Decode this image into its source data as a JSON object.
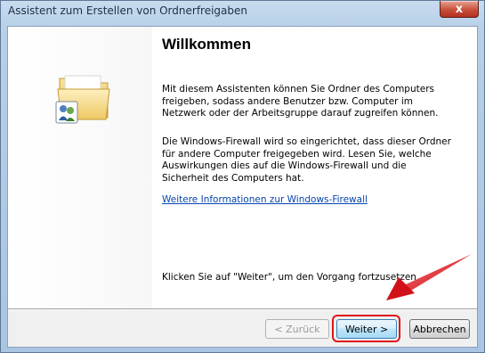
{
  "window": {
    "title": "Assistent zum Erstellen von Ordnerfreigaben",
    "close_label": "x"
  },
  "content": {
    "heading": "Willkommen",
    "paragraph1": "Mit diesem Assistenten können Sie Ordner des Computers freigeben, sodass andere Benutzer bzw. Computer im Netzwerk oder der Arbeitsgruppe darauf zugreifen können.",
    "paragraph2": "Die Windows-Firewall wird so eingerichtet, dass dieser Ordner für andere Computer freigegeben wird. Lesen Sie, welche Auswirkungen dies auf die Windows-Firewall und die Sicherheit des Computers hat.",
    "link": "Weitere Informationen zur Windows-Firewall",
    "paragraph3": "Klicken Sie auf \"Weiter\", um den Vorgang fortzusetzen."
  },
  "buttons": {
    "back": "< Zurück",
    "next": "Weiter >",
    "cancel": "Abbrechen"
  },
  "icons": {
    "wizard": "shared-folder-icon",
    "annotation": "red-arrow"
  },
  "colors": {
    "link": "#0645ad",
    "highlight": "#e0161c"
  }
}
